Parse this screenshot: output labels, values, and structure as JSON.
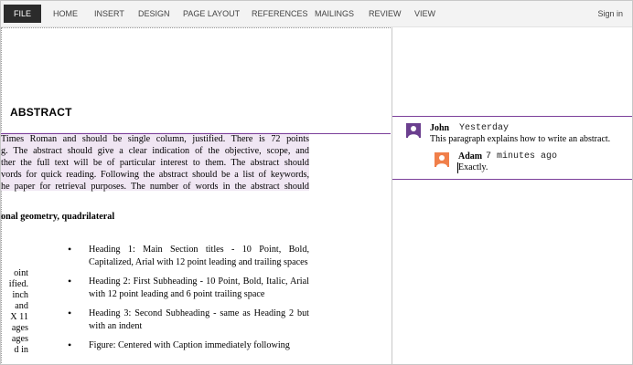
{
  "ribbon": {
    "tabs": [
      "FILE",
      "HOME",
      "INSERT",
      "DESIGN",
      "PAGE LAYOUT",
      "REFERENCES",
      "MAILINGS",
      "REVIEW",
      "VIEW"
    ],
    "sign_in": "Sign in"
  },
  "document": {
    "heading": "ABSTRACT",
    "abstract_lines": [
      " Times Roman and should be single column, justified. There is 72 points",
      "g.  The abstract should give a clear indication of the objective, scope, and",
      "ther the full text will be of particular interest to them.  The abstract should",
      "vords for quick reading. Following the abstract should be a list of keywords,",
      "he paper for retrieval purposes.  The number of words in the abstract should"
    ],
    "keywords_line": "onal geometry, quadrilateral",
    "left_fragments": [
      "oint",
      "ified.",
      "inch",
      "and",
      "X 11",
      "ages",
      "ages",
      "d in"
    ],
    "bullets": [
      "Heading 1: Main Section titles - 10 Point, Bold, Capitalized, Arial with 12 point leading and trailing spaces",
      "Heading 2: First Subheading - 10 Point, Bold, Italic, Arial with 12 point leading and 6 point trailing space",
      "Heading 3: Second Subheading - same as Heading 2 but with an indent",
      "Figure: Centered with Caption immediately following"
    ]
  },
  "comments": [
    {
      "author": "John",
      "time": "Yesterday",
      "text": "This paragraph explains how to write an abstract.",
      "color": "#6b3f8f",
      "reply": {
        "author": "Adam",
        "time": "7 minutes ago",
        "text": "Exactly.",
        "color": "#f07f4a"
      }
    }
  ],
  "colors": {
    "comment_accent": "#7b3f9a",
    "highlight": "#f0e6f3",
    "file_tab": "#2b2b2b"
  }
}
